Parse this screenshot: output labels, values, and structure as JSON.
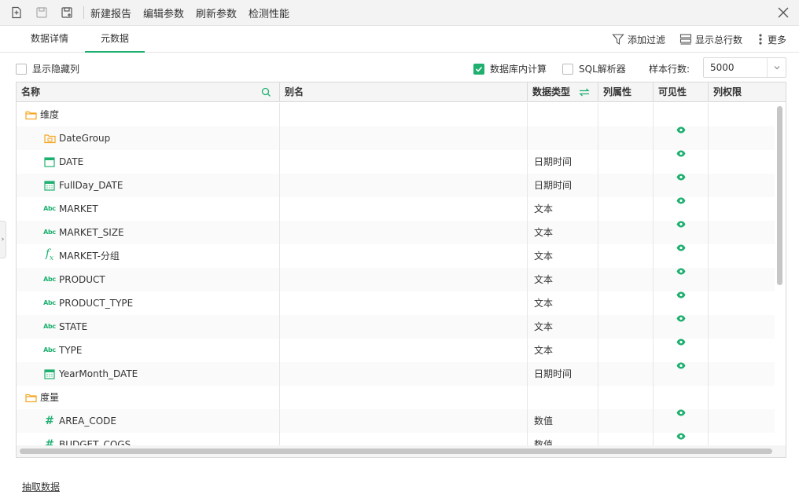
{
  "toolbar": {
    "icons": [
      "new-report-icon",
      "save-icon",
      "save-as-icon"
    ],
    "items": [
      "新建报告",
      "编辑参数",
      "刷新参数",
      "检测性能"
    ],
    "close": "close-icon"
  },
  "tabs": [
    "数据详情",
    "元数据"
  ],
  "active_tab": "元数据",
  "actions": {
    "add_filter": "添加过滤",
    "show_total": "显示总行数",
    "more": "更多"
  },
  "options": {
    "show_hidden": "显示隐藏列",
    "db_compute": "数据库内计算",
    "sql_parser": "SQL解析器",
    "sample_label": "样本行数:",
    "sample_value": "5000"
  },
  "columns": {
    "name": "名称",
    "alias": "别名",
    "type": "数据类型",
    "attr": "列属性",
    "visible": "可见性",
    "perm": "列权限"
  },
  "rows": [
    {
      "name": "维度",
      "icon": "folder-icon",
      "indent": 0,
      "type": "",
      "visible": false
    },
    {
      "name": "DateGroup",
      "icon": "date-group-icon",
      "indent": 1,
      "type": "",
      "visible": true
    },
    {
      "name": "DATE",
      "icon": "calendar-icon",
      "indent": 1,
      "type": "日期时间",
      "visible": true
    },
    {
      "name": "FullDay_DATE",
      "icon": "calendar-grid-icon",
      "indent": 1,
      "type": "日期时间",
      "visible": true
    },
    {
      "name": "MARKET",
      "icon": "text-field-icon",
      "indent": 1,
      "type": "文本",
      "visible": true
    },
    {
      "name": "MARKET_SIZE",
      "icon": "text-field-icon",
      "indent": 1,
      "type": "文本",
      "visible": true
    },
    {
      "name": "MARKET-分组",
      "icon": "formula-icon",
      "indent": 1,
      "type": "文本",
      "visible": true
    },
    {
      "name": "PRODUCT",
      "icon": "text-field-icon",
      "indent": 1,
      "type": "文本",
      "visible": true
    },
    {
      "name": "PRODUCT_TYPE",
      "icon": "text-field-icon",
      "indent": 1,
      "type": "文本",
      "visible": true
    },
    {
      "name": "STATE",
      "icon": "text-field-icon",
      "indent": 1,
      "type": "文本",
      "visible": true
    },
    {
      "name": "TYPE",
      "icon": "text-field-icon",
      "indent": 1,
      "type": "文本",
      "visible": true
    },
    {
      "name": "YearMonth_DATE",
      "icon": "calendar-grid-icon",
      "indent": 1,
      "type": "日期时间",
      "visible": true
    },
    {
      "name": "度量",
      "icon": "folder-icon",
      "indent": 0,
      "type": "",
      "visible": false
    },
    {
      "name": "AREA_CODE",
      "icon": "number-field-icon",
      "indent": 1,
      "type": "数值",
      "visible": true
    },
    {
      "name": "BUDGET_COGS",
      "icon": "number-field-icon",
      "indent": 1,
      "type": "数值",
      "visible": true
    }
  ],
  "footer": {
    "extract": "抽取数据"
  },
  "colors": {
    "accent": "#1fb070",
    "folder": "#f5a623"
  }
}
